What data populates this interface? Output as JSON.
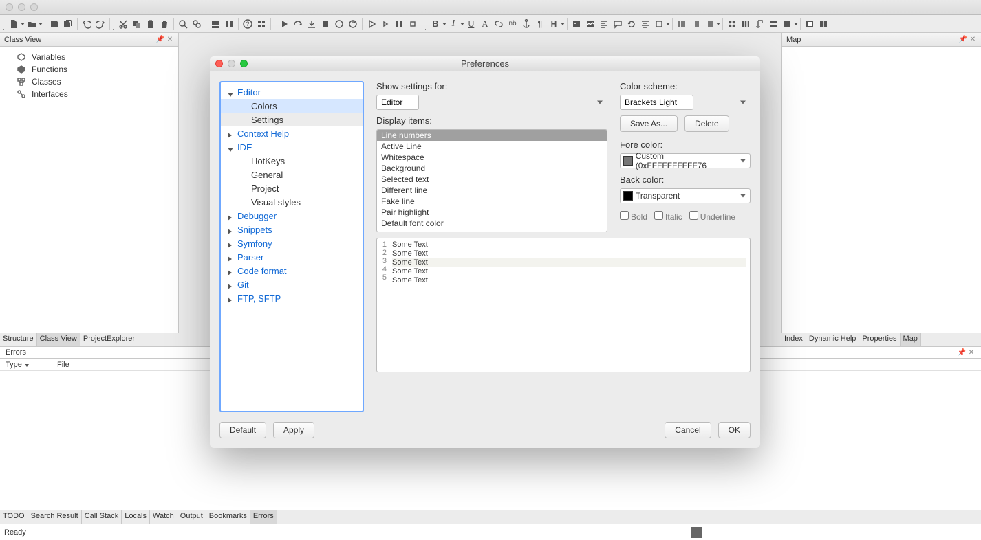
{
  "window": {
    "title": ""
  },
  "class_view": {
    "title": "Class View",
    "items": [
      "Variables",
      "Functions",
      "Classes",
      "Interfaces"
    ]
  },
  "map_panel": {
    "title": "Map"
  },
  "left_tabs": [
    "Structure",
    "Class View",
    "ProjectExplorer"
  ],
  "right_tabs": [
    "Index",
    "Dynamic Help",
    "Properties",
    "Map"
  ],
  "errors": {
    "title": "Errors",
    "cols": {
      "type": "Type",
      "file": "File"
    }
  },
  "bottom_tabs": [
    "TODO",
    "Search Result",
    "Call Stack",
    "Locals",
    "Watch",
    "Output",
    "Bookmarks",
    "Errors"
  ],
  "status": {
    "ready": "Ready"
  },
  "dialog": {
    "title": "Preferences",
    "tree": {
      "editor": {
        "label": "Editor",
        "children": [
          "Colors",
          "Settings"
        ]
      },
      "context_help": "Context Help",
      "ide": {
        "label": "IDE",
        "children": [
          "HotKeys",
          "General",
          "Project",
          "Visual styles"
        ]
      },
      "debugger": "Debugger",
      "snippets": "Snippets",
      "symfony": "Symfony",
      "parser": "Parser",
      "code_format": "Code format",
      "git": "Git",
      "ftp": "FTP, SFTP"
    },
    "show_label": "Show settings for:",
    "show_value": "Editor",
    "scheme_label": "Color scheme:",
    "scheme_value": "Brackets Light",
    "display_label": "Display items:",
    "display_items": [
      "Line numbers",
      "Active Line",
      "Whitespace",
      "Background",
      "Selected text",
      "Different line",
      "Fake line",
      "Pair highlight",
      "Default font color"
    ],
    "saveas": "Save As...",
    "delete": "Delete",
    "fore_label": "Fore color:",
    "fore_value": "Custom (0xFFFFFFFFFF76",
    "back_label": "Back color:",
    "back_value": "Transparent",
    "bold": "Bold",
    "italic": "Italic",
    "underline": "Underline",
    "preview_line": "Some Text",
    "default": "Default",
    "apply": "Apply",
    "cancel": "Cancel",
    "ok": "OK"
  }
}
